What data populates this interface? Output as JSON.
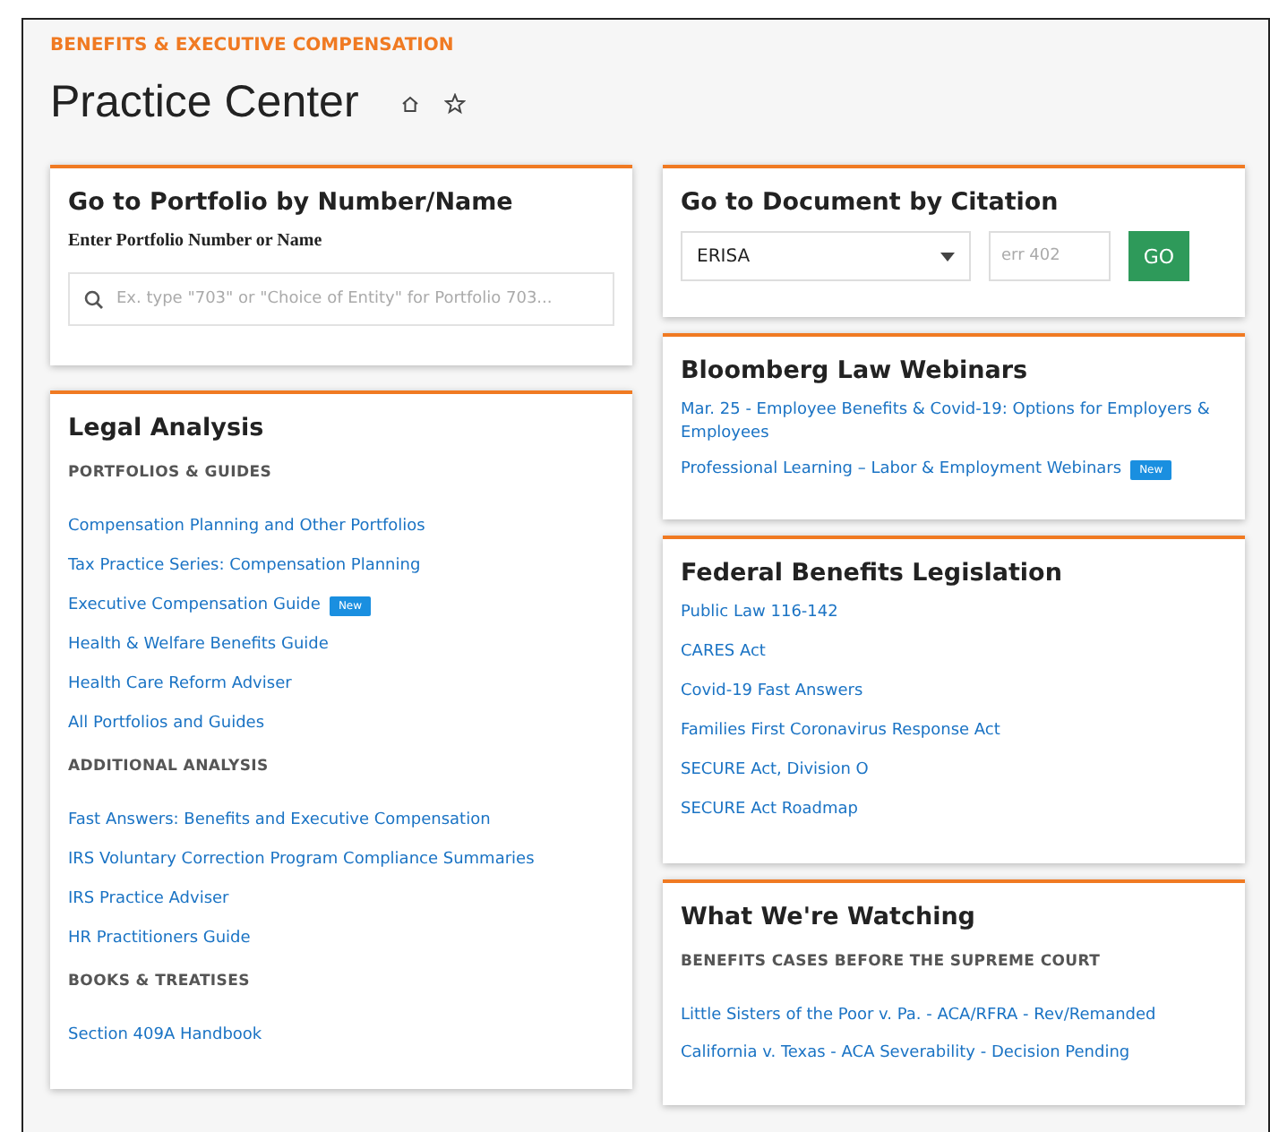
{
  "header": {
    "eyebrow": "BENEFITS & EXECUTIVE COMPENSATION",
    "title": "Practice Center"
  },
  "portfolio_lookup": {
    "title": "Go to Portfolio by Number/Name",
    "label": "Enter Portfolio Number or Name",
    "placeholder": "Ex. type \"703\" or \"Choice of Entity\" for Portfolio 703..."
  },
  "legal_analysis": {
    "title": "Legal Analysis",
    "groups": [
      {
        "heading": "PORTFOLIOS & GUIDES",
        "links": [
          {
            "text": "Compensation Planning and Other Portfolios"
          },
          {
            "text": "Tax Practice Series: Compensation Planning"
          },
          {
            "text": "Executive Compensation Guide",
            "badge": "New"
          },
          {
            "text": "Health & Welfare Benefits Guide"
          },
          {
            "text": "Health Care Reform Adviser"
          },
          {
            "text": "All Portfolios and Guides"
          }
        ]
      },
      {
        "heading": "ADDITIONAL ANALYSIS",
        "links": [
          {
            "text": "Fast Answers: Benefits and Executive Compensation"
          },
          {
            "text": "IRS Voluntary Correction Program Compliance Summaries"
          },
          {
            "text": "IRS Practice Adviser"
          },
          {
            "text": "HR Practitioners Guide"
          }
        ]
      },
      {
        "heading": "BOOKS & TREATISES",
        "links": [
          {
            "text": "Section 409A Handbook"
          }
        ]
      }
    ]
  },
  "citation_lookup": {
    "title": "Go to Document by Citation",
    "source": "ERISA",
    "placeholder": "err 402",
    "button": "GO"
  },
  "webinars": {
    "title": "Bloomberg Law Webinars",
    "links": [
      {
        "text": "Mar. 25 - Employee Benefits & Covid-19: Options for Employers & Employees"
      },
      {
        "text": "Professional Learning – Labor & Employment Webinars",
        "badge": "New"
      }
    ]
  },
  "legislation": {
    "title": "Federal Benefits Legislation",
    "links": [
      {
        "text": "Public Law 116-142"
      },
      {
        "text": "CARES Act"
      },
      {
        "text": "Covid-19 Fast Answers"
      },
      {
        "text": "Families First Coronavirus Response Act"
      },
      {
        "text": "SECURE  Act, Division O"
      },
      {
        "text": "SECURE Act Roadmap"
      }
    ]
  },
  "watching": {
    "title": "What We're Watching",
    "groups": [
      {
        "heading": "BENEFITS CASES BEFORE THE SUPREME COURT",
        "links": [
          {
            "text": "Little Sisters of the Poor v. Pa. - ACA/RFRA - Rev/Remanded"
          },
          {
            "text": "California v. Texas - ACA Severability - Decision Pending"
          }
        ]
      }
    ]
  }
}
